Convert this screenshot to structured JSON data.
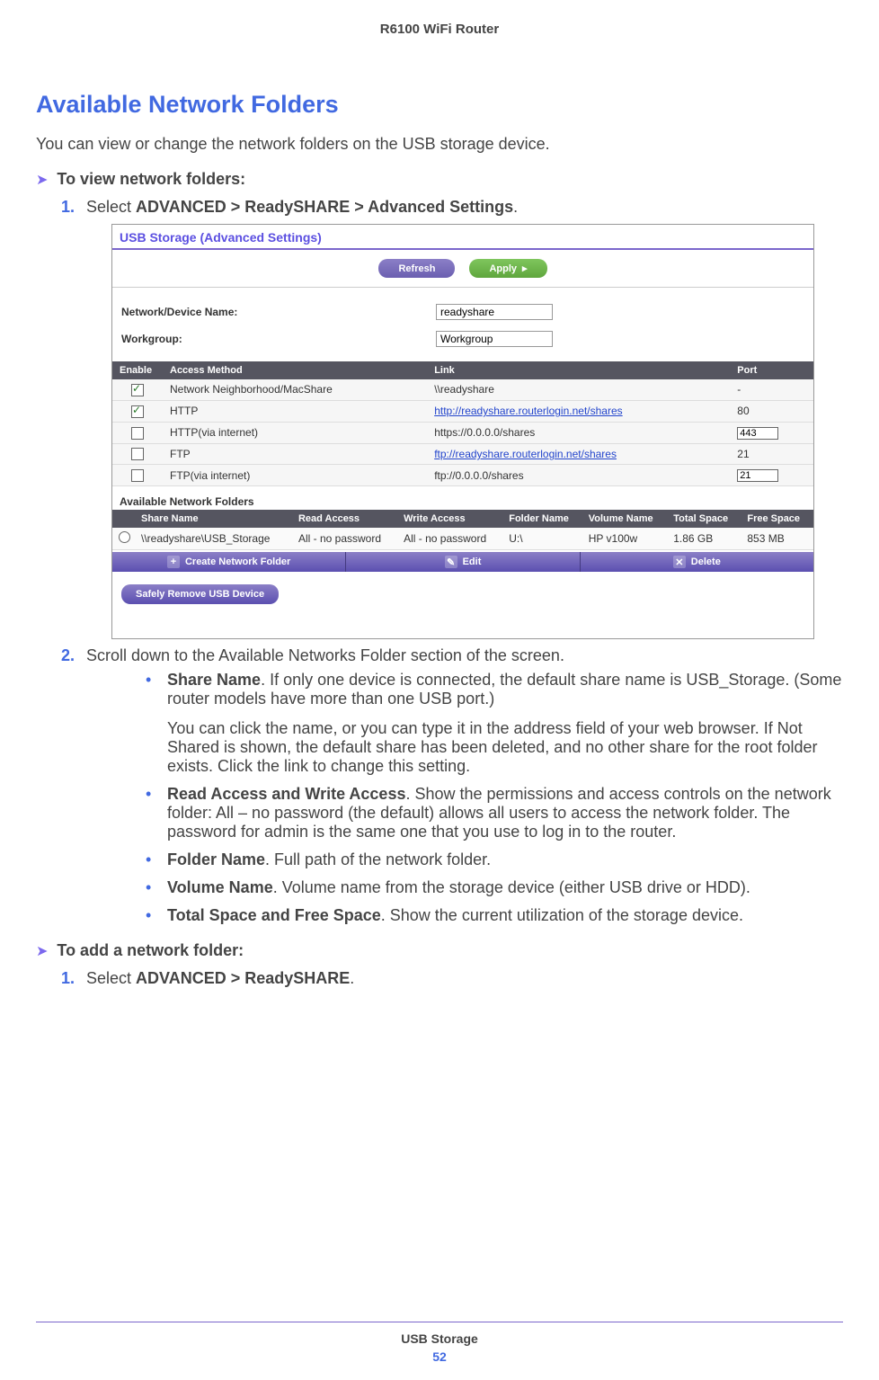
{
  "header": {
    "product": "R6100 WiFi Router"
  },
  "section": {
    "title": "Available Network Folders",
    "intro": "You can view or change the network folders on the USB storage device."
  },
  "proc_view": {
    "heading": "To view network folders:",
    "step1_num": "1.",
    "step1_prefix": "Select ",
    "step1_bold": "ADVANCED > ReadySHARE > Advanced Settings",
    "step1_suffix": ".",
    "step2_num": "2.",
    "step2_text": "Scroll down to the Available Networks Folder section of the screen."
  },
  "shot": {
    "title": "USB Storage (Advanced Settings)",
    "refresh": "Refresh",
    "apply": "Apply",
    "apply_arrow": "▸",
    "net_dev_label": "Network/Device Name:",
    "net_dev_value": "readyshare",
    "workgroup_label": "Workgroup:",
    "workgroup_value": "Workgroup",
    "cols": {
      "enable": "Enable",
      "method": "Access Method",
      "link": "Link",
      "port": "Port"
    },
    "rows": [
      {
        "checked": true,
        "method": "Network Neighborhood/MacShare",
        "link": "\\\\readyshare",
        "is_link": false,
        "port": "-",
        "port_input": false
      },
      {
        "checked": true,
        "method": "HTTP",
        "link": "http://readyshare.routerlogin.net/shares",
        "is_link": true,
        "port": "80",
        "port_input": false
      },
      {
        "checked": false,
        "method": "HTTP(via internet)",
        "link": "https://0.0.0.0/shares",
        "is_link": false,
        "port": "443",
        "port_input": true
      },
      {
        "checked": false,
        "method": "FTP",
        "link": "ftp://readyshare.routerlogin.net/shares",
        "is_link": true,
        "port": "21",
        "port_input": false
      },
      {
        "checked": false,
        "method": "FTP(via internet)",
        "link": "ftp://0.0.0.0/shares",
        "is_link": false,
        "port": "21",
        "port_input": true
      }
    ],
    "avail_heading": "Available Network Folders",
    "cols2": {
      "share": "Share Name",
      "read": "Read Access",
      "write": "Write Access",
      "folder": "Folder Name",
      "vol": "Volume Name",
      "total": "Total Space",
      "free": "Free Space"
    },
    "row2": {
      "share": "\\\\readyshare\\USB_Storage",
      "read": "All - no password",
      "write": "All - no password",
      "folder": "U:\\",
      "vol": "HP v100w",
      "total": "1.86 GB",
      "free": "853 MB"
    },
    "actions": {
      "create_icon": "+",
      "create": "Create Network Folder",
      "edit_icon": "✎",
      "edit": "Edit",
      "delete_icon": "✕",
      "delete": "Delete"
    },
    "safe": "Safely Remove USB Device"
  },
  "bullets": {
    "share_bold": "Share Name",
    "share_text": ". If only one device is connected, the default share name is USB_Storage. (Some router models have more than one USB port.)",
    "share_para": "You can click the name, or you can type it in the address field of your web browser. If Not Shared is shown, the default share has been deleted, and no other share for the root folder exists. Click the link to change this setting.",
    "rw_bold": "Read Access and Write Access",
    "rw_text": ". Show the permissions and access controls on the network folder: All – no password (the default) allows all users to access the network folder. The password for admin is the same one that you use to log in to the router.",
    "folder_bold": "Folder Name",
    "folder_text": ". Full path of the network folder.",
    "vol_bold": "Volume Name",
    "vol_text": ". Volume name from the storage device (either USB drive or HDD).",
    "space_bold": "Total Space and Free Space",
    "space_text": ". Show the current utilization of the storage device."
  },
  "proc_add": {
    "heading": "To add a network folder:",
    "step1_num": "1.",
    "step1_prefix": "Select ",
    "step1_bold": "ADVANCED > ReadySHARE",
    "step1_suffix": "."
  },
  "footer": {
    "section": "USB Storage",
    "page": "52"
  }
}
